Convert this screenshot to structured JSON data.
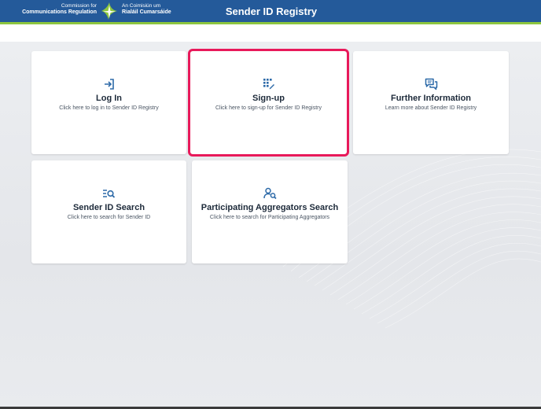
{
  "header": {
    "logo_left_line1": "Commission for",
    "logo_left_line2": "Communications Regulation",
    "logo_right_line1": "An Coimisiún um",
    "logo_right_line2": "Rialáil Cumarsáide",
    "title": "Sender ID Registry",
    "colors": {
      "bar": "#245a9a",
      "stripe": "#8dc63f"
    }
  },
  "cards": [
    {
      "id": "login",
      "icon": "login-arrow-icon",
      "title": "Log In",
      "description": "Click here to log in to Sender ID Registry"
    },
    {
      "id": "signup",
      "icon": "keypad-pencil-icon",
      "title": "Sign-up",
      "description": "Click here to sign-up for Sender ID Registry",
      "highlighted": true
    },
    {
      "id": "info",
      "icon": "chat-bubbles-icon",
      "title": "Further Information",
      "description": "Learn more about Sender ID Registry"
    },
    {
      "id": "search",
      "icon": "list-search-icon",
      "title": "Sender ID Search",
      "description": "Click here to search for Sender ID"
    },
    {
      "id": "aggregators",
      "icon": "user-search-icon",
      "title": "Participating Aggregators Search",
      "description": "Click here to search for Participating Aggregators"
    }
  ],
  "colors": {
    "icon": "#2d6aa8",
    "highlight": "#e8195a"
  }
}
